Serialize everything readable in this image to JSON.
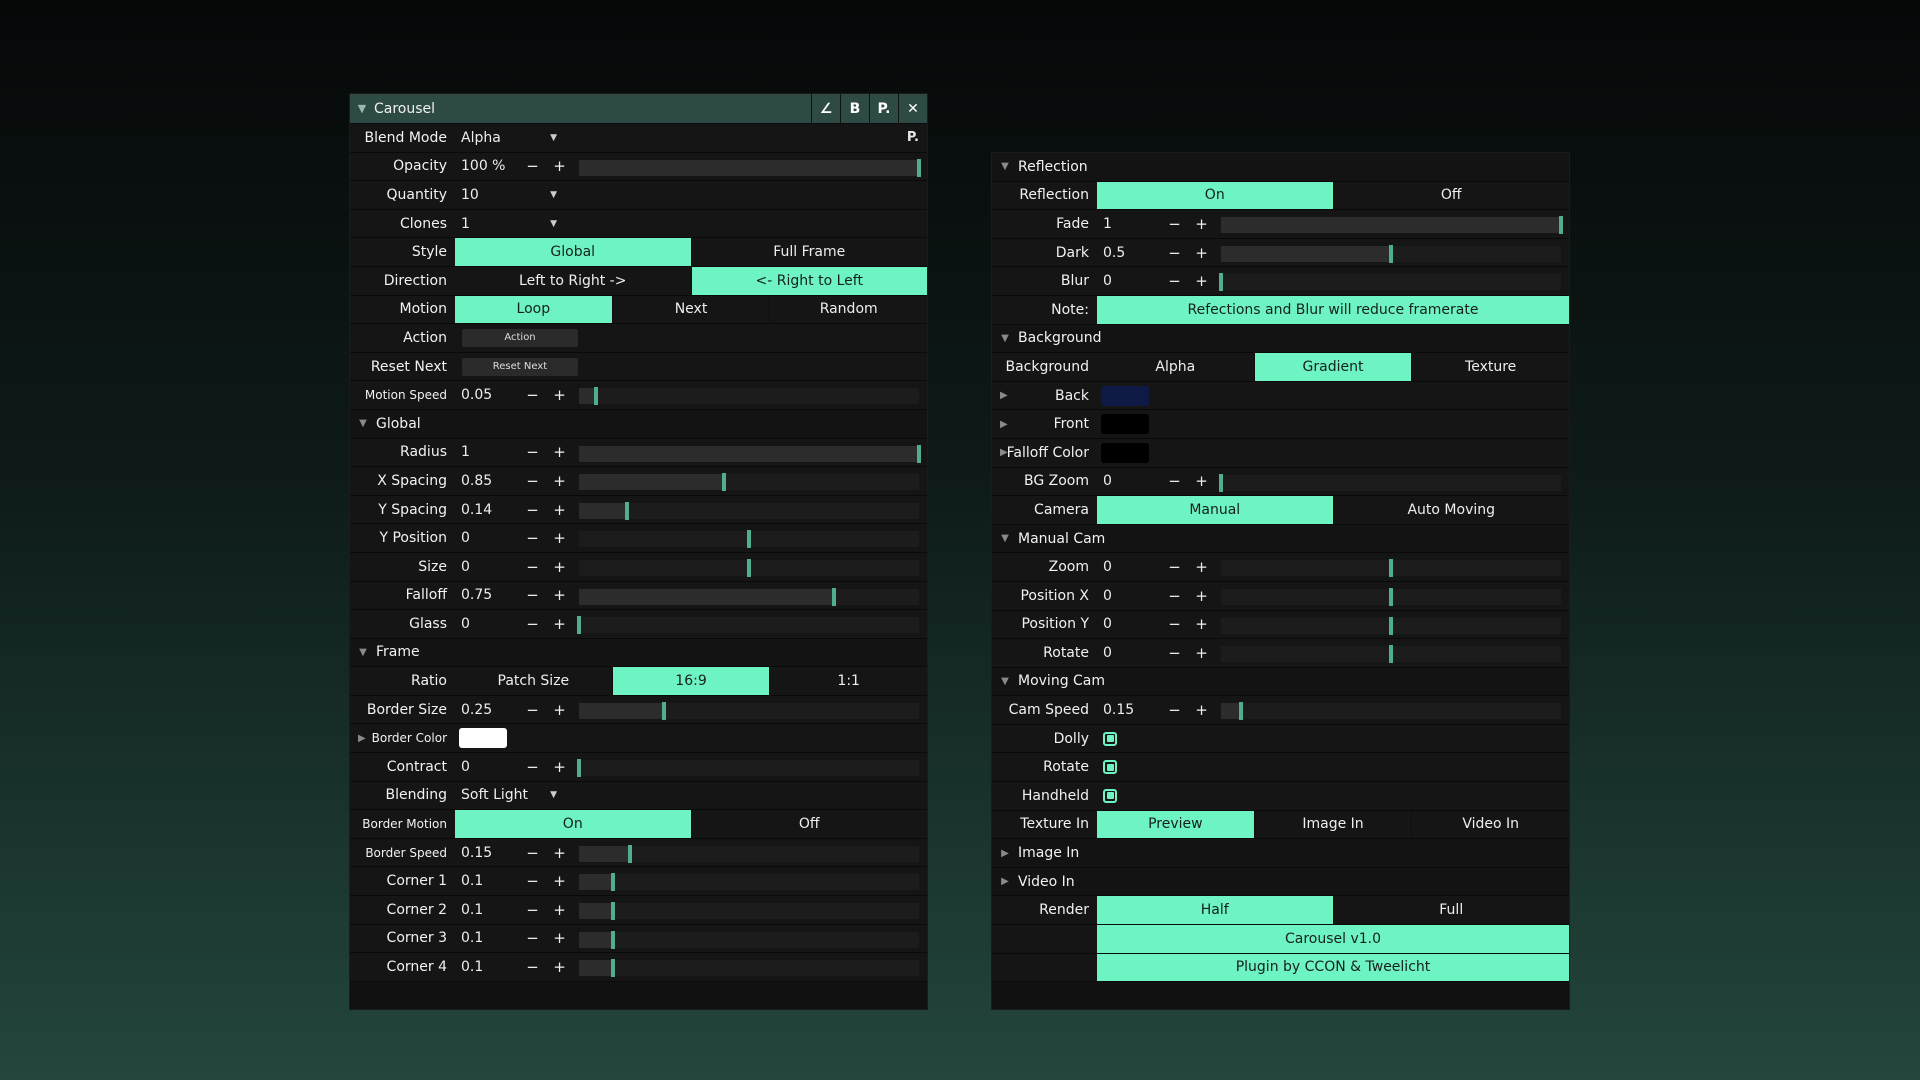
{
  "left": {
    "title": "Carousel",
    "title_buttons": [
      "∠",
      "B",
      "P.",
      "✕"
    ],
    "blend_mode": {
      "label": "Blend Mode",
      "value": "Alpha",
      "p_button": "P."
    },
    "opacity": {
      "label": "Opacity",
      "value": "100 %",
      "level": 1.0
    },
    "quantity": {
      "label": "Quantity",
      "value": "10"
    },
    "clones": {
      "label": "Clones",
      "value": "1"
    },
    "style": {
      "label": "Style",
      "options": [
        "Global",
        "Full Frame"
      ],
      "selected": 0
    },
    "direction": {
      "label": "Direction",
      "options": [
        "Left to Right  ->",
        "<-  Right to Left"
      ],
      "selected": 1
    },
    "motion": {
      "label": "Motion",
      "options": [
        "Loop",
        "Next",
        "Random"
      ],
      "selected": 0
    },
    "action": {
      "label": "Action",
      "button": "Action"
    },
    "reset_next": {
      "label": "Reset Next",
      "button": "Reset Next"
    },
    "motion_speed": {
      "label": "Motion Speed",
      "value": "0.05",
      "level": 0.05
    },
    "global_section": "Global",
    "radius": {
      "label": "Radius",
      "value": "1",
      "level": 1.0
    },
    "x_spacing": {
      "label": "X Spacing",
      "value": "0.85",
      "level": 0.425
    },
    "y_spacing": {
      "label": "Y Spacing",
      "value": "0.14",
      "level": 0.14
    },
    "y_position": {
      "label": "Y Position",
      "value": "0",
      "level": 0.5
    },
    "size": {
      "label": "Size",
      "value": "0",
      "level": 0.5
    },
    "falloff": {
      "label": "Falloff",
      "value": "0.75",
      "level": 0.75
    },
    "glass": {
      "label": "Glass",
      "value": "0",
      "level": 0.0
    },
    "frame_section": "Frame",
    "ratio": {
      "label": "Ratio",
      "options": [
        "Patch Size",
        "16:9",
        "1:1"
      ],
      "selected": 1
    },
    "border_size": {
      "label": "Border Size",
      "value": "0.25",
      "level": 0.25
    },
    "border_color": {
      "label": "Border Color",
      "color": "#ffffff"
    },
    "contract": {
      "label": "Contract",
      "value": "0",
      "level": 0.0
    },
    "blending": {
      "label": "Blending",
      "value": "Soft Light"
    },
    "border_motion": {
      "label": "Border Motion",
      "options": [
        "On",
        "Off"
      ],
      "selected": 0
    },
    "border_speed": {
      "label": "Border Speed",
      "value": "0.15",
      "level": 0.15
    },
    "corner1": {
      "label": "Corner 1",
      "value": "0.1",
      "level": 0.1
    },
    "corner2": {
      "label": "Corner 2",
      "value": "0.1",
      "level": 0.1
    },
    "corner3": {
      "label": "Corner 3",
      "value": "0.1",
      "level": 0.1
    },
    "corner4": {
      "label": "Corner 4",
      "value": "0.1",
      "level": 0.1
    }
  },
  "right": {
    "reflection_section": "Reflection",
    "reflection": {
      "label": "Reflection",
      "options": [
        "On",
        "Off"
      ],
      "selected": 0
    },
    "fade": {
      "label": "Fade",
      "value": "1",
      "level": 1.0
    },
    "dark": {
      "label": "Dark",
      "value": "0.5",
      "level": 0.5
    },
    "blur": {
      "label": "Blur",
      "value": "0",
      "level": 0.0
    },
    "note": {
      "label": "Note:",
      "text": "Refections and Blur will reduce framerate"
    },
    "background_section": "Background",
    "background": {
      "label": "Background",
      "options": [
        "Alpha",
        "Gradient",
        "Texture"
      ],
      "selected": 1
    },
    "back": {
      "label": "Back",
      "color": "#0f1a44"
    },
    "front": {
      "label": "Front",
      "color": "#000000"
    },
    "falloff_color": {
      "label": "Falloff Color",
      "color": "#000000"
    },
    "bg_zoom": {
      "label": "BG Zoom",
      "value": "0",
      "level": 0.0
    },
    "camera": {
      "label": "Camera",
      "options": [
        "Manual",
        "Auto Moving"
      ],
      "selected": 0
    },
    "manual_cam_section": "Manual Cam",
    "zoom": {
      "label": "Zoom",
      "value": "0",
      "level": 0.5
    },
    "position_x": {
      "label": "Position X",
      "value": "0",
      "level": 0.5
    },
    "position_y": {
      "label": "Position Y",
      "value": "0",
      "level": 0.5
    },
    "rotate": {
      "label": "Rotate",
      "value": "0",
      "level": 0.5
    },
    "moving_cam_section": "Moving Cam",
    "cam_speed": {
      "label": "Cam Speed",
      "value": "0.15",
      "level": 0.06
    },
    "dolly": {
      "label": "Dolly",
      "checked": true
    },
    "rotate_chk": {
      "label": "Rotate",
      "checked": true
    },
    "handheld": {
      "label": "Handheld",
      "checked": true
    },
    "texture_in": {
      "label": "Texture In",
      "options": [
        "Preview",
        "Image In",
        "Video In"
      ],
      "selected": 0
    },
    "image_in": "Image In",
    "video_in": "Video In",
    "render": {
      "label": "Render",
      "options": [
        "Half",
        "Full"
      ],
      "selected": 0
    },
    "version": "Carousel v1.0",
    "credits": "Plugin by CCON & Tweelicht"
  },
  "colors": {
    "accent": "#6ef4c2",
    "thumb": "#4fae92",
    "title_bar": "#2e4a44"
  }
}
